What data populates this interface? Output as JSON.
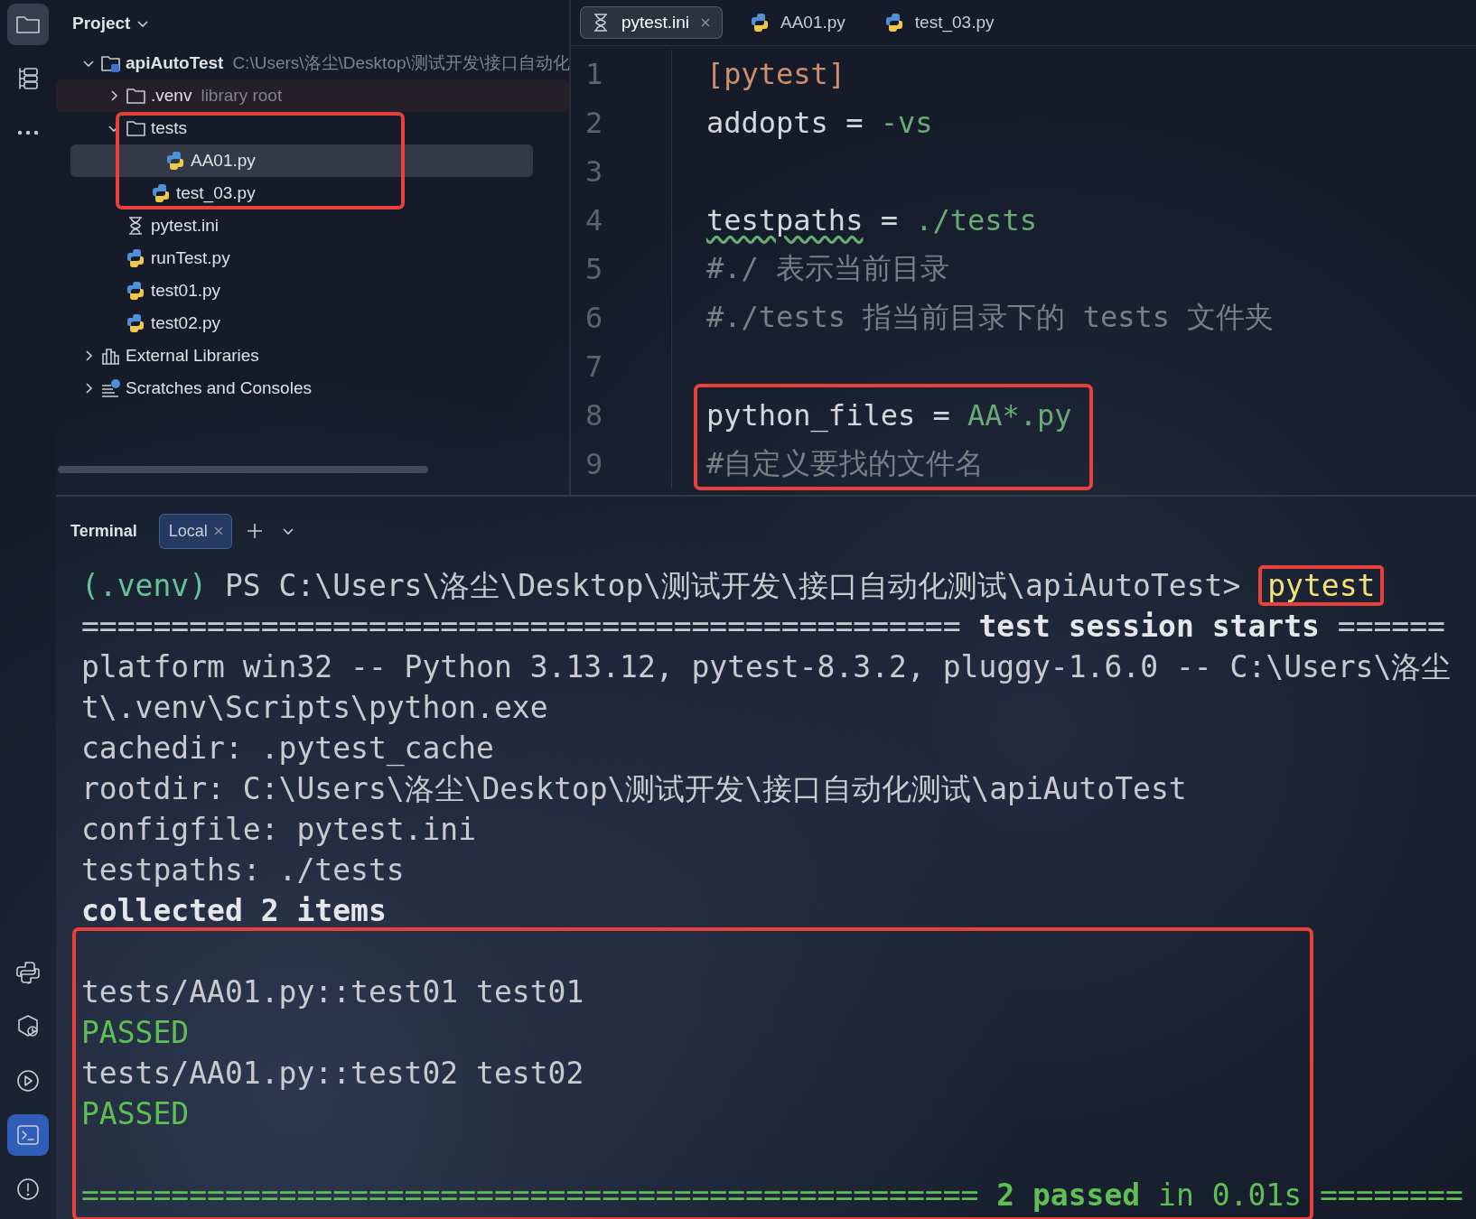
{
  "tool_strip": {
    "top": [
      {
        "kind": "folder",
        "selected": true
      },
      {
        "kind": "structure",
        "selected": false
      },
      {
        "kind": "more",
        "selected": false
      }
    ],
    "bottom": [
      {
        "kind": "packages",
        "selected": false
      },
      {
        "kind": "console",
        "selected": false
      },
      {
        "kind": "services",
        "selected": false
      },
      {
        "kind": "terminal",
        "selected": true
      },
      {
        "kind": "problems",
        "selected": false
      }
    ]
  },
  "project": {
    "title": "Project",
    "tree": [
      {
        "label": "apiAutoTest",
        "kind": "project",
        "hint": "C:\\Users\\洛尘\\Desktop\\测试开发\\接口自动化",
        "expanded": true,
        "selected": false,
        "highlighted": false,
        "children": [
          {
            "label": ".venv",
            "kind": "folder",
            "hint": "library root",
            "tinted": true,
            "expanded": false,
            "selected": false,
            "highlighted": false
          },
          {
            "label": "tests",
            "kind": "folder",
            "expanded": true,
            "selected": false,
            "highlighted": true,
            "children": [
              {
                "label": "AA01.py",
                "kind": "python",
                "selected": true,
                "highlighted": false
              },
              {
                "label": "test_03.py",
                "kind": "python",
                "selected": false,
                "highlighted": false
              }
            ]
          },
          {
            "label": "pytest.ini",
            "kind": "ini",
            "selected": false,
            "highlighted": false
          },
          {
            "label": "runTest.py",
            "kind": "python",
            "selected": false,
            "highlighted": false
          },
          {
            "label": "test01.py",
            "kind": "python",
            "selected": false,
            "highlighted": false
          },
          {
            "label": "test02.py",
            "kind": "python",
            "selected": false,
            "highlighted": false
          }
        ]
      },
      {
        "label": "External Libraries",
        "kind": "library",
        "expanded": false,
        "selected": false,
        "highlighted": false
      },
      {
        "label": "Scratches and Consoles",
        "kind": "scratches",
        "expanded": false,
        "selected": false,
        "highlighted": false
      }
    ]
  },
  "editor": {
    "tabs": [
      {
        "label": "pytest.ini",
        "kind": "ini",
        "selected": true
      },
      {
        "label": "AA01.py",
        "kind": "python",
        "selected": false
      },
      {
        "label": "test_03.py",
        "kind": "python",
        "selected": false
      }
    ],
    "lines": [
      {
        "number": "1",
        "highlighted": false,
        "segments": [
          {
            "text": "[pytest]",
            "kind": "section"
          }
        ]
      },
      {
        "number": "2",
        "highlighted": false,
        "segments": [
          {
            "text": "addopts = ",
            "kind": "key"
          },
          {
            "text": "-vs",
            "kind": "value"
          }
        ]
      },
      {
        "number": "3",
        "highlighted": false
      },
      {
        "number": "4",
        "highlighted": false,
        "segments": [
          {
            "text": "testpaths",
            "kind": "key_warning"
          },
          {
            "text": " = ",
            "kind": "key"
          },
          {
            "text": "./tests",
            "kind": "value"
          }
        ]
      },
      {
        "number": "5",
        "highlighted": false,
        "segments": [
          {
            "text": "#./ 表示当前目录",
            "kind": "comment"
          }
        ]
      },
      {
        "number": "6",
        "highlighted": false,
        "segments": [
          {
            "text": "#./tests 指当前目录下的 tests 文件夹",
            "kind": "comment"
          }
        ]
      },
      {
        "number": "7",
        "highlighted": false
      },
      {
        "number": "8",
        "highlighted": true,
        "segments": [
          {
            "text": "python_files = ",
            "kind": "key"
          },
          {
            "text": "AA*.py",
            "kind": "value"
          }
        ]
      },
      {
        "number": "9",
        "highlighted": true,
        "segments": [
          {
            "text": "#自定义要找的文件名",
            "kind": "comment"
          }
        ]
      }
    ]
  },
  "terminal": {
    "title": "Terminal",
    "tabs": [
      {
        "label": "Local",
        "selected": true
      }
    ],
    "lines": [
      {
        "highlighted": false,
        "segments": [
          {
            "text": "(.venv)",
            "kind": "venv",
            "highlighted": false
          },
          {
            "text": " PS C:\\Users\\洛尘\\Desktop\\测试开发\\接口自动化测试\\apiAutoTest> ",
            "kind": "plain",
            "highlighted": false
          },
          {
            "text": "pytest",
            "kind": "command",
            "highlighted": true
          }
        ]
      },
      {
        "highlighted": false,
        "segments": [
          {
            "text": "================================================= ",
            "kind": "plain"
          },
          {
            "text": "test session starts",
            "kind": "bold"
          },
          {
            "text": " ======",
            "kind": "plain"
          }
        ]
      },
      {
        "highlighted": false,
        "segments": [
          {
            "text": "platform win32 -- Python 3.13.12, pytest-8.3.2, pluggy-1.6.0 -- C:\\Users\\洛尘",
            "kind": "plain"
          }
        ]
      },
      {
        "highlighted": false,
        "segments": [
          {
            "text": "t\\.venv\\Scripts\\python.exe",
            "kind": "plain"
          }
        ]
      },
      {
        "highlighted": false,
        "segments": [
          {
            "text": "cachedir: .pytest_cache",
            "kind": "plain"
          }
        ]
      },
      {
        "highlighted": false,
        "segments": [
          {
            "text": "rootdir: C:\\Users\\洛尘\\Desktop\\测试开发\\接口自动化测试\\apiAutoTest",
            "kind": "plain"
          }
        ]
      },
      {
        "highlighted": false,
        "segments": [
          {
            "text": "configfile: pytest.ini",
            "kind": "plain"
          }
        ]
      },
      {
        "highlighted": false,
        "segments": [
          {
            "text": "testpaths: ./tests",
            "kind": "plain"
          }
        ]
      },
      {
        "highlighted": false,
        "segments": [
          {
            "text": "collected 2 items",
            "kind": "bold"
          }
        ]
      },
      {
        "highlighted": true,
        "space_before": true,
        "segments": [
          {
            "text": "tests/AA01.py::test01 test01",
            "kind": "plain"
          }
        ]
      },
      {
        "highlighted": true,
        "segments": [
          {
            "text": "PASSED",
            "kind": "green"
          }
        ]
      },
      {
        "highlighted": true,
        "segments": [
          {
            "text": "tests/AA01.py::test02 test02",
            "kind": "plain"
          }
        ]
      },
      {
        "highlighted": true,
        "segments": [
          {
            "text": "PASSED",
            "kind": "green"
          }
        ]
      },
      {
        "highlighted": true,
        "space_before": true,
        "segments": [
          {
            "text": "================================================== ",
            "kind": "green"
          },
          {
            "text": "2 passed",
            "kind": "green_bold"
          },
          {
            "text": " in 0.01s ",
            "kind": "green"
          },
          {
            "text": "========",
            "kind": "green"
          }
        ]
      }
    ]
  }
}
